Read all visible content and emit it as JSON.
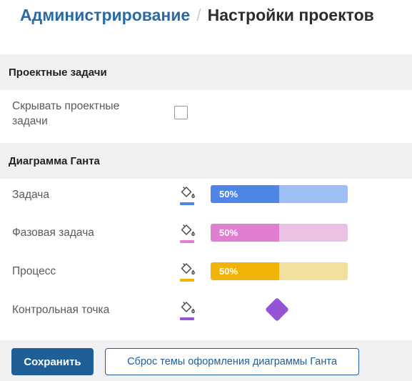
{
  "breadcrumb": {
    "parent": "Администрирование",
    "separator": "/",
    "current": "Настройки проектов"
  },
  "sections": {
    "project_tasks": {
      "title": "Проектные задачи",
      "hide_label": "Скрывать проектные задачи",
      "hide_checked": false
    },
    "gantt": {
      "title": "Диаграмма Ганта",
      "rows": [
        {
          "label": "Задача",
          "icon": "paint-bucket-icon",
          "percent": "50%",
          "progress": 0.5,
          "color_main": "#4f86e6",
          "color_light": "#9ebef5"
        },
        {
          "label": "Фазовая задача",
          "icon": "paint-bucket-icon",
          "percent": "50%",
          "progress": 0.5,
          "color_main": "#e07fcf",
          "color_light": "#ecc2e4"
        },
        {
          "label": "Процесс",
          "icon": "paint-bucket-icon",
          "percent": "50%",
          "progress": 0.5,
          "color_main": "#efb407",
          "color_light": "#f1df9f"
        },
        {
          "label": "Контрольная точка",
          "icon": "paint-bucket-icon",
          "color_main": "#9554d8"
        }
      ]
    }
  },
  "footer": {
    "save_label": "Сохранить",
    "reset_label": "Сброс темы оформления диаграммы Ганта"
  }
}
